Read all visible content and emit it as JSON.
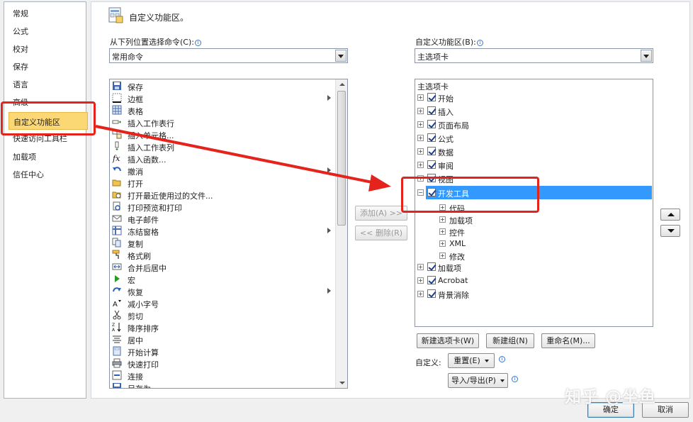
{
  "nav": {
    "items": [
      "常规",
      "公式",
      "校对",
      "保存",
      "语言",
      "高级",
      "自定义功能区",
      "快速访问工具栏",
      "加载项",
      "信任中心"
    ]
  },
  "main": {
    "title": "自定义功能区。",
    "left_label": "从下列位置选择命令(C):",
    "left_combo": "常用命令",
    "right_label": "自定义功能区(B):",
    "right_combo": "主选项卡"
  },
  "commands": [
    "保存",
    "边框",
    "表格",
    "插入工作表行",
    "插入单元格...",
    "插入工作表列",
    "插入函数...",
    "撤消",
    "打开",
    "打开最近使用过的文件...",
    "打印预览和打印",
    "电子邮件",
    "冻结窗格",
    "复制",
    "格式刷",
    "合并后居中",
    "宏",
    "恢复",
    "减小字号",
    "剪切",
    "降序排序",
    "居中",
    "开始计算",
    "快速打印",
    "连接",
    "另存为"
  ],
  "buttons": {
    "add": "添加(A) >>",
    "remove": "<< 删除(R)",
    "new_tab": "新建选项卡(W)",
    "new_group": "新建组(N)",
    "rename": "重命名(M)...",
    "customize_label": "自定义:",
    "reset": "重置(E)",
    "import_export": "导入/导出(P)",
    "ok": "确定",
    "cancel": "取消"
  },
  "tree": {
    "header": "主选项卡",
    "tabs": [
      "开始",
      "插入",
      "页面布局",
      "公式",
      "数据",
      "审阅",
      "视图"
    ],
    "dev_tab": "开发工具",
    "dev_groups": [
      "代码",
      "加载项",
      "控件",
      "XML",
      "修改"
    ],
    "after_tabs": [
      "加载项",
      "Acrobat",
      "背景消除"
    ]
  },
  "watermark": "知乎 @坐鱼",
  "colors": {
    "selection": "#3399ff",
    "nav_selected": "#fcd874",
    "annotation": "#e5231d"
  }
}
